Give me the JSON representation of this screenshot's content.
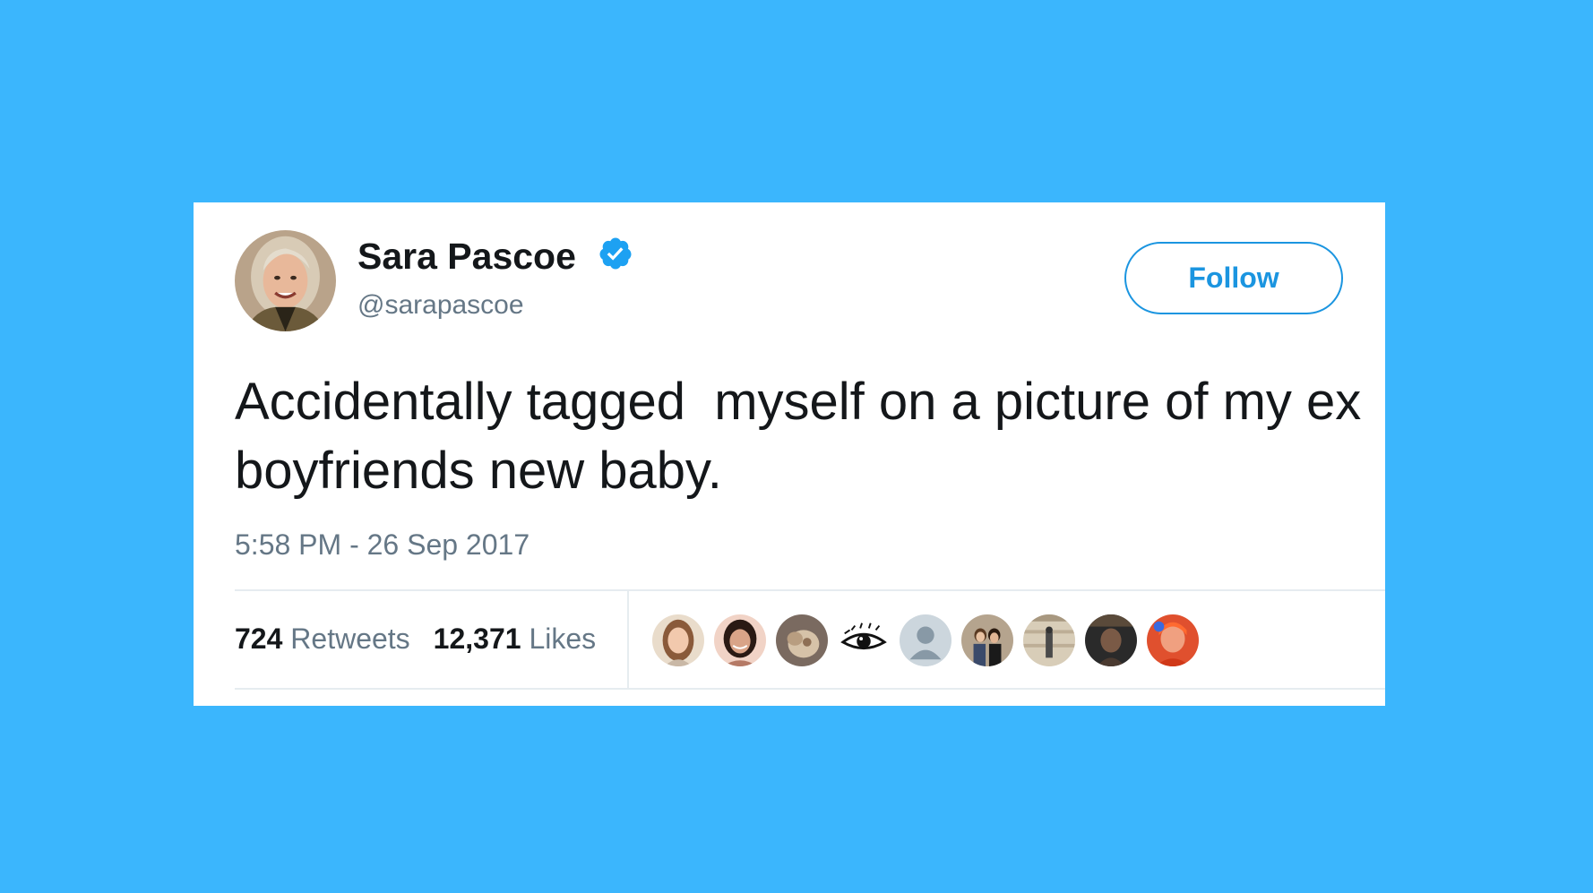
{
  "tweet": {
    "display_name": "Sara Pascoe",
    "handle": "@sarapascoe",
    "verified": true,
    "follow_label": "Follow",
    "text": "Accidentally tagged  myself on a picture of my ex boyfriends new baby.",
    "timestamp": "5:58 PM - 26 Sep 2017",
    "retweets_count": "724",
    "retweets_label": "Retweets",
    "likes_count": "12,371",
    "likes_label": "Likes"
  },
  "likers": [
    {
      "icon": "liker-avatar-1-icon"
    },
    {
      "icon": "liker-avatar-2-icon"
    },
    {
      "icon": "liker-avatar-3-icon"
    },
    {
      "icon": "liker-avatar-eye-icon"
    },
    {
      "icon": "liker-avatar-default-icon"
    },
    {
      "icon": "liker-avatar-6-icon"
    },
    {
      "icon": "liker-avatar-7-icon"
    },
    {
      "icon": "liker-avatar-8-icon"
    },
    {
      "icon": "liker-avatar-9-icon"
    }
  ],
  "colors": {
    "background": "#3bb6fd",
    "accent": "#1b95e0",
    "text_primary": "#14171a",
    "text_secondary": "#657786",
    "verified": "#1da1f2"
  }
}
